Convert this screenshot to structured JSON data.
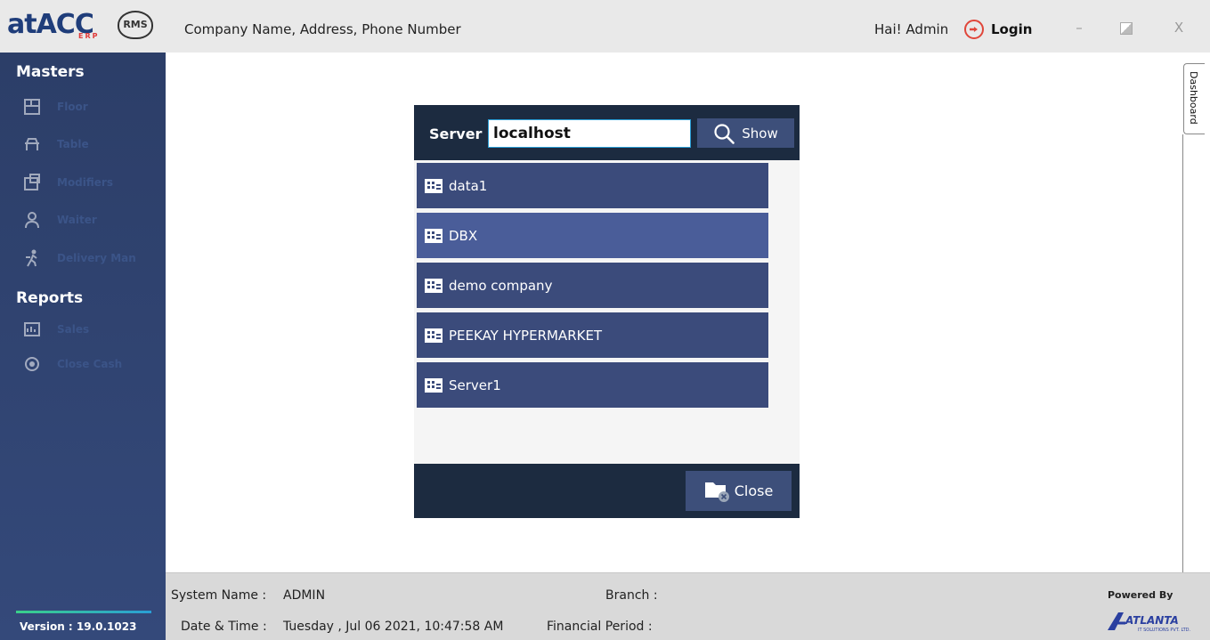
{
  "header": {
    "company": "Company Name, Address, Phone Number",
    "greeting": "Hai! Admin",
    "login_label": "Login",
    "minimize_label": "–",
    "close_label": "X"
  },
  "sidebar": {
    "masters_title": "Masters",
    "masters_items": [
      {
        "label": "Floor",
        "icon": "floor-icon"
      },
      {
        "label": "Table",
        "icon": "table-icon"
      },
      {
        "label": "Modifiers",
        "icon": "modifiers-icon"
      },
      {
        "label": "Waiter",
        "icon": "waiter-icon"
      },
      {
        "label": "Delivery Man",
        "icon": "delivery-man-icon"
      }
    ],
    "reports_title": "Reports",
    "reports_items": [
      {
        "label": "Sales",
        "icon": "sales-icon"
      },
      {
        "label": "Close Cash",
        "icon": "close-cash-icon"
      }
    ],
    "version": "Version :  19.0.1023"
  },
  "dashboard_tab": {
    "label": "Dashboard"
  },
  "dialog": {
    "server_label": "Server",
    "server_value": "localhost",
    "show_label": "Show",
    "databases": [
      {
        "name": "data1",
        "selected": false
      },
      {
        "name": "DBX",
        "selected": true
      },
      {
        "name": "demo company",
        "selected": false
      },
      {
        "name": "PEEKAY HYPERMARKET",
        "selected": false
      },
      {
        "name": "Server1",
        "selected": false
      }
    ],
    "close_label": "Close"
  },
  "status": {
    "system_name_label": "System Name :",
    "system_name_value": "ADMIN",
    "date_label": "Date & Time :",
    "date_value": "Tuesday , Jul 06 2021, 10:47:58 AM",
    "branch_label": "Branch :",
    "financial_label": "Financial Period :",
    "powered_by": "Powered By"
  },
  "branding": {
    "logo_text": "atACC",
    "logo_sub": "ERP",
    "logo_badge": "RMS",
    "powered_logo_text": "ATLANTA",
    "powered_logo_sub": "IT SOLUTIONS PVT. LTD."
  },
  "colors": {
    "sidebar": "#2c3e68",
    "dialog_header": "#1c2b40",
    "list_item": "#3b4b7b",
    "list_item_selected": "#4a5d99",
    "accent": "#2a9fd6"
  }
}
